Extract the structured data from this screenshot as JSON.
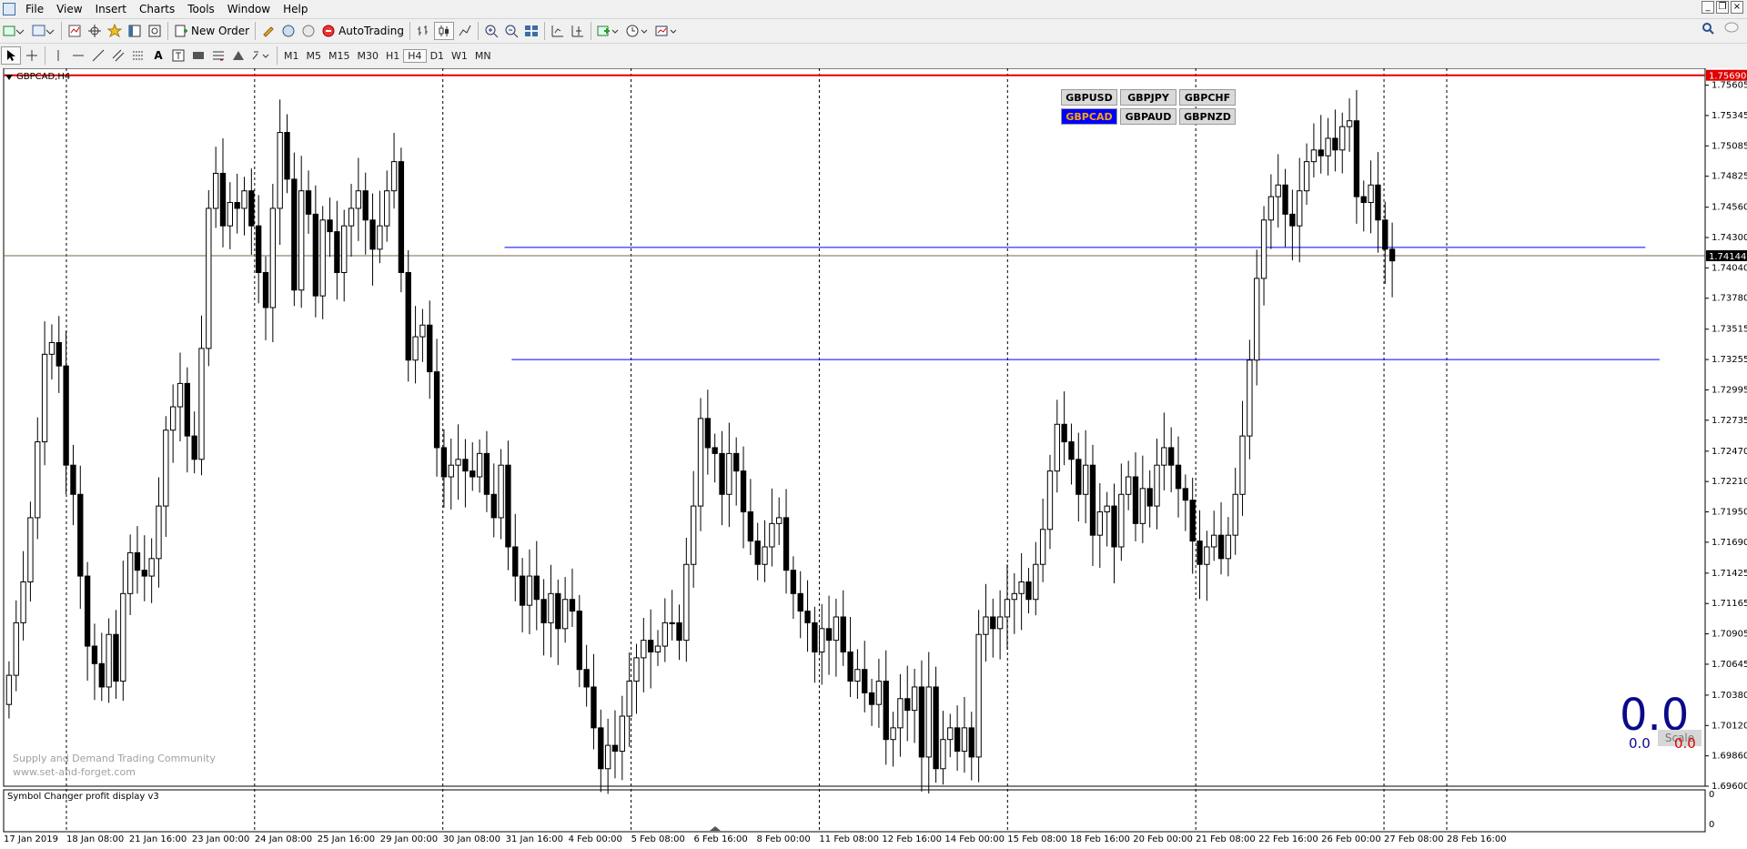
{
  "menu": [
    "File",
    "View",
    "Insert",
    "Charts",
    "Tools",
    "Window",
    "Help"
  ],
  "toolbar": {
    "new_order": "New Order",
    "autotrading": "AutoTrading"
  },
  "timeframes": [
    "M1",
    "M5",
    "M15",
    "M30",
    "H1",
    "H4",
    "D1",
    "W1",
    "MN"
  ],
  "active_timeframe": "H4",
  "chart": {
    "label": "GBPCAD,H4",
    "watermark_line1": "Supply and Demand Trading Community",
    "watermark_line2": "www.set-and-forget.com",
    "indicator_label": "Symbol Changer profit display v3",
    "profit_big": "0.0",
    "profit_small": "0.0",
    "profit_red": "0.0",
    "scale_label": "Scale",
    "subwindow_scale": [
      "0",
      "0"
    ]
  },
  "symbols": [
    "GBPUSD",
    "GBPJPY",
    "GBPCHF",
    "GBPCAD",
    "GBPAUD",
    "GBPNZD"
  ],
  "active_symbol": "GBPCAD",
  "chart_data": {
    "type": "candlestick",
    "symbol": "GBPCAD",
    "timeframe": "H4",
    "y_ticks": [
      "1.75605",
      "1.75345",
      "1.75085",
      "1.74825",
      "1.74560",
      "1.74300",
      "1.74040",
      "1.73780",
      "1.73515",
      "1.73255",
      "1.72995",
      "1.72735",
      "1.72470",
      "1.72210",
      "1.71950",
      "1.71690",
      "1.71425",
      "1.71165",
      "1.70905",
      "1.70645",
      "1.70380",
      "1.70120",
      "1.69860",
      "1.69600"
    ],
    "ylim": [
      1.696,
      1.7575
    ],
    "x_ticks": [
      "17 Jan 2019",
      "18 Jan 08:00",
      "21 Jan 16:00",
      "23 Jan 00:00",
      "24 Jan 08:00",
      "25 Jan 16:00",
      "29 Jan 00:00",
      "30 Jan 08:00",
      "31 Jan 16:00",
      "4 Feb 00:00",
      "5 Feb 08:00",
      "6 Feb 16:00",
      "8 Feb 00:00",
      "11 Feb 08:00",
      "12 Feb 16:00",
      "14 Feb 00:00",
      "15 Feb 08:00",
      "18 Feb 16:00",
      "20 Feb 00:00",
      "21 Feb 08:00",
      "22 Feb 16:00",
      "26 Feb 00:00",
      "27 Feb 08:00",
      "28 Feb 16:00"
    ],
    "current_price": "1.74144",
    "current_price_value": 1.74144,
    "red_line_label": "1.75690",
    "red_line_value": 1.7569,
    "horizontal_lines": [
      {
        "value": 1.74215,
        "color": "#0000ff",
        "from_bar": 70,
        "to_bar": 230
      },
      {
        "value": 1.73255,
        "color": "#0000ff",
        "from_bar": 71,
        "to_bar": 232
      }
    ],
    "closes": [
      1.7055,
      1.71,
      1.7135,
      1.719,
      1.7255,
      1.733,
      1.734,
      1.732,
      1.7235,
      1.721,
      1.714,
      1.708,
      1.7065,
      1.7045,
      1.709,
      1.705,
      1.7125,
      1.716,
      1.7145,
      1.714,
      1.7155,
      1.72,
      1.7265,
      1.7285,
      1.7305,
      1.726,
      1.724,
      1.7335,
      1.7455,
      1.7485,
      1.744,
      1.746,
      1.7455,
      1.747,
      1.744,
      1.74,
      1.737,
      1.7455,
      1.752,
      1.748,
      1.7385,
      1.747,
      1.745,
      1.738,
      1.7445,
      1.7435,
      1.74,
      1.744,
      1.7455,
      1.747,
      1.7445,
      1.742,
      1.744,
      1.747,
      1.7495,
      1.74,
      1.7325,
      1.7345,
      1.7355,
      1.7315,
      1.725,
      1.7225,
      1.7235,
      1.724,
      1.723,
      1.7225,
      1.7245,
      1.721,
      1.719,
      1.7235,
      1.7165,
      1.714,
      1.7115,
      1.714,
      1.712,
      1.71,
      1.7125,
      1.7095,
      1.712,
      1.711,
      1.706,
      1.7045,
      1.701,
      1.6975,
      1.6995,
      1.699,
      1.702,
      1.705,
      1.707,
      1.7085,
      1.7075,
      1.708,
      1.71,
      1.71,
      1.7085,
      1.715,
      1.72,
      1.7275,
      1.725,
      1.7245,
      1.721,
      1.7245,
      1.723,
      1.7195,
      1.717,
      1.715,
      1.7165,
      1.7185,
      1.719,
      1.7145,
      1.7125,
      1.711,
      1.71,
      1.7075,
      1.7095,
      1.7085,
      1.7105,
      1.7075,
      1.705,
      1.706,
      1.704,
      1.703,
      1.705,
      1.7,
      1.701,
      1.7035,
      1.7025,
      1.7045,
      1.6985,
      1.7045,
      1.6975,
      1.7,
      1.701,
      1.699,
      1.701,
      1.6985,
      1.709,
      1.7105,
      1.7095,
      1.7105,
      1.712,
      1.7125,
      1.7135,
      1.712,
      1.715,
      1.718,
      1.723,
      1.727,
      1.7255,
      1.724,
      1.721,
      1.7235,
      1.7175,
      1.7195,
      1.72,
      1.7165,
      1.721,
      1.7225,
      1.7185,
      1.7215,
      1.72,
      1.7235,
      1.725,
      1.7235,
      1.7215,
      1.7205,
      1.717,
      1.715,
      1.7165,
      1.7175,
      1.7155,
      1.7175,
      1.721,
      1.726,
      1.7325,
      1.7395,
      1.7445,
      1.7465,
      1.7475,
      1.745,
      1.744,
      1.747,
      1.7495,
      1.7505,
      1.75,
      1.7515,
      1.7505,
      1.7525,
      1.753,
      1.7465,
      1.746,
      1.7475,
      1.7445,
      1.742,
      1.741
    ],
    "close_start": 1.703,
    "trend_line_value": 1.74144
  }
}
